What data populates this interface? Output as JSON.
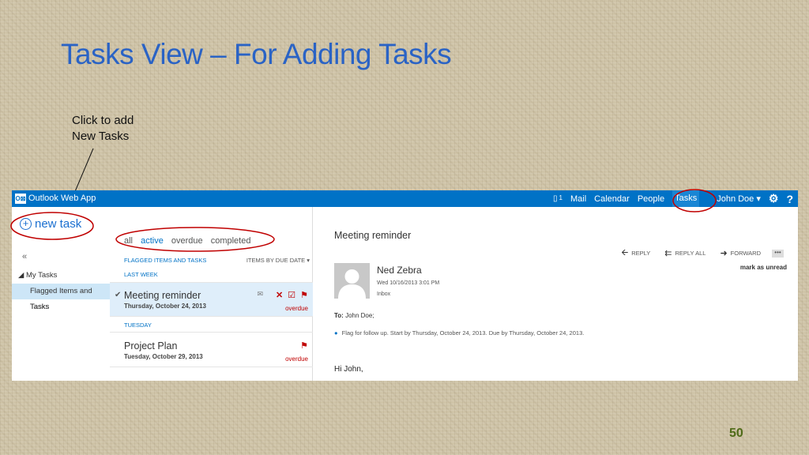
{
  "slide": {
    "title": "Tasks View – For Adding Tasks",
    "callout_line1": "Click to add",
    "callout_line2": "New Tasks",
    "page_number": "50"
  },
  "topbar": {
    "app_name": "Outlook Web App",
    "logo_glyph": "O⊠",
    "notification_count": "1",
    "nav": [
      "Mail",
      "Calendar",
      "People",
      "Tasks"
    ],
    "active_nav": "Tasks",
    "user": "John Doe ▾",
    "settings_icon": "gear-icon",
    "help_label": "?",
    "color": "#0072c6"
  },
  "left_nav": {
    "new_task_label": "new task",
    "collapse_label": "«",
    "section_label": "◢ My Tasks",
    "items": [
      "Flagged Items and Tasks",
      "Tasks"
    ],
    "selected_item": "Flagged Items and Tasks"
  },
  "task_list": {
    "filters": [
      "all",
      "active",
      "overdue",
      "completed"
    ],
    "active_filter": "active",
    "header_label": "FLAGGED ITEMS AND TASKS",
    "sort_label": "ITEMS BY DUE DATE ▾",
    "groups": [
      {
        "label": "LAST WEEK",
        "tasks": [
          {
            "title": "Meeting reminder",
            "date": "Thursday, October 24, 2013",
            "status": "overdue",
            "selected": true
          }
        ]
      },
      {
        "label": "TUESDAY",
        "tasks": [
          {
            "title": "Project Plan",
            "date": "Tuesday, October 29, 2013",
            "status": "overdue",
            "selected": false
          }
        ]
      }
    ]
  },
  "reading_pane": {
    "subject": "Meeting reminder",
    "actions": [
      "REPLY",
      "REPLY ALL",
      "FORWARD"
    ],
    "more_label": "•••",
    "mark_unread_label": "mark as unread",
    "sender": "Ned Zebra",
    "sent": "Wed 10/16/2013 3:01 PM",
    "folder": "Inbox",
    "to_label": "To:",
    "to_value": "John Doe;",
    "flag_info": "Flag for follow up. Start by Thursday, October 24, 2013. Due by Thursday, October 24, 2013.",
    "greeting": "Hi John,"
  }
}
